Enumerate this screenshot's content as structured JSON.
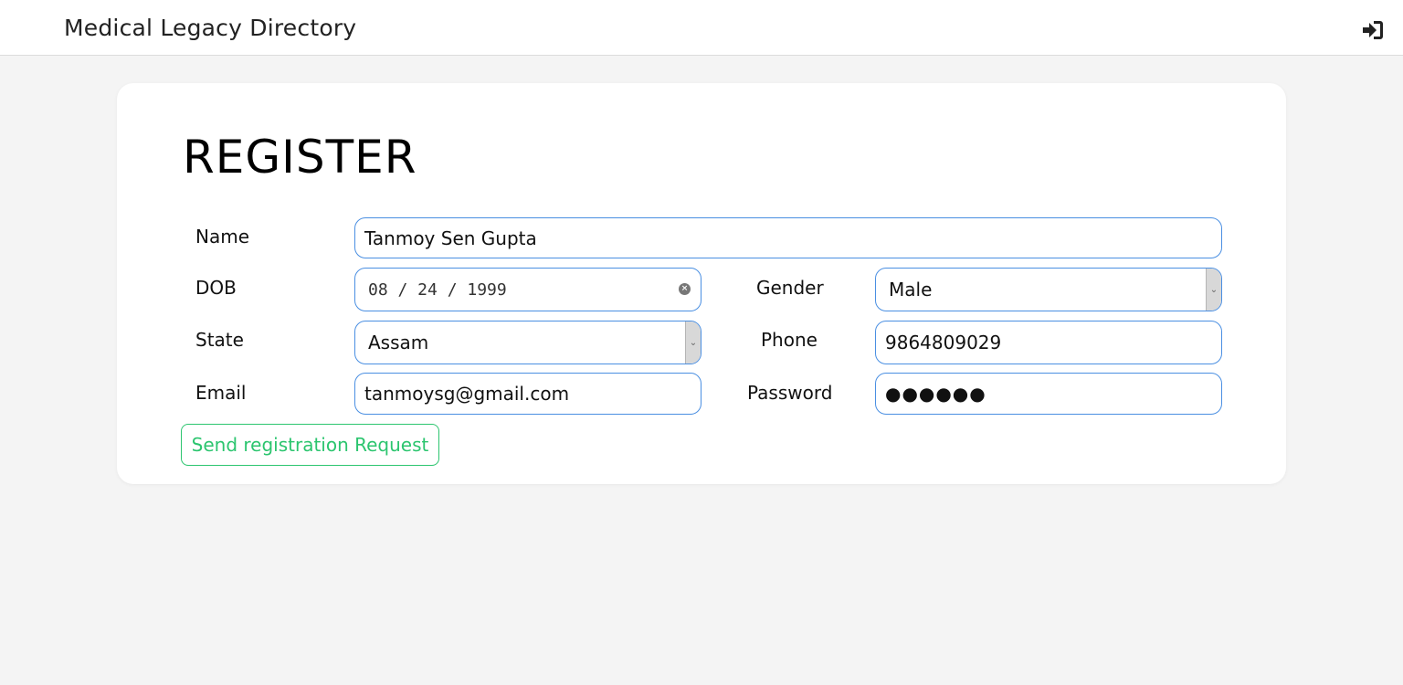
{
  "header": {
    "brand": "Medical Legacy Directory",
    "login_icon": "sign-in-icon"
  },
  "form": {
    "title": "REGISTER",
    "name": {
      "label": "Name",
      "value": "Tanmoy Sen Gupta"
    },
    "dob": {
      "label": "DOB",
      "value": "08 / 24 / 1999"
    },
    "gender": {
      "label": "Gender",
      "value": "Male"
    },
    "state": {
      "label": "State",
      "value": "Assam"
    },
    "phone": {
      "label": "Phone",
      "value": "9864809029"
    },
    "email": {
      "label": "Email",
      "value": "tanmoysg@gmail.com"
    },
    "password": {
      "label": "Password",
      "value": "●●●●●●"
    },
    "submit_label": "Send registration Request"
  },
  "colors": {
    "accent_green": "#2cc56f",
    "input_border": "#4a8fe2",
    "background": "#f4f4f4"
  }
}
